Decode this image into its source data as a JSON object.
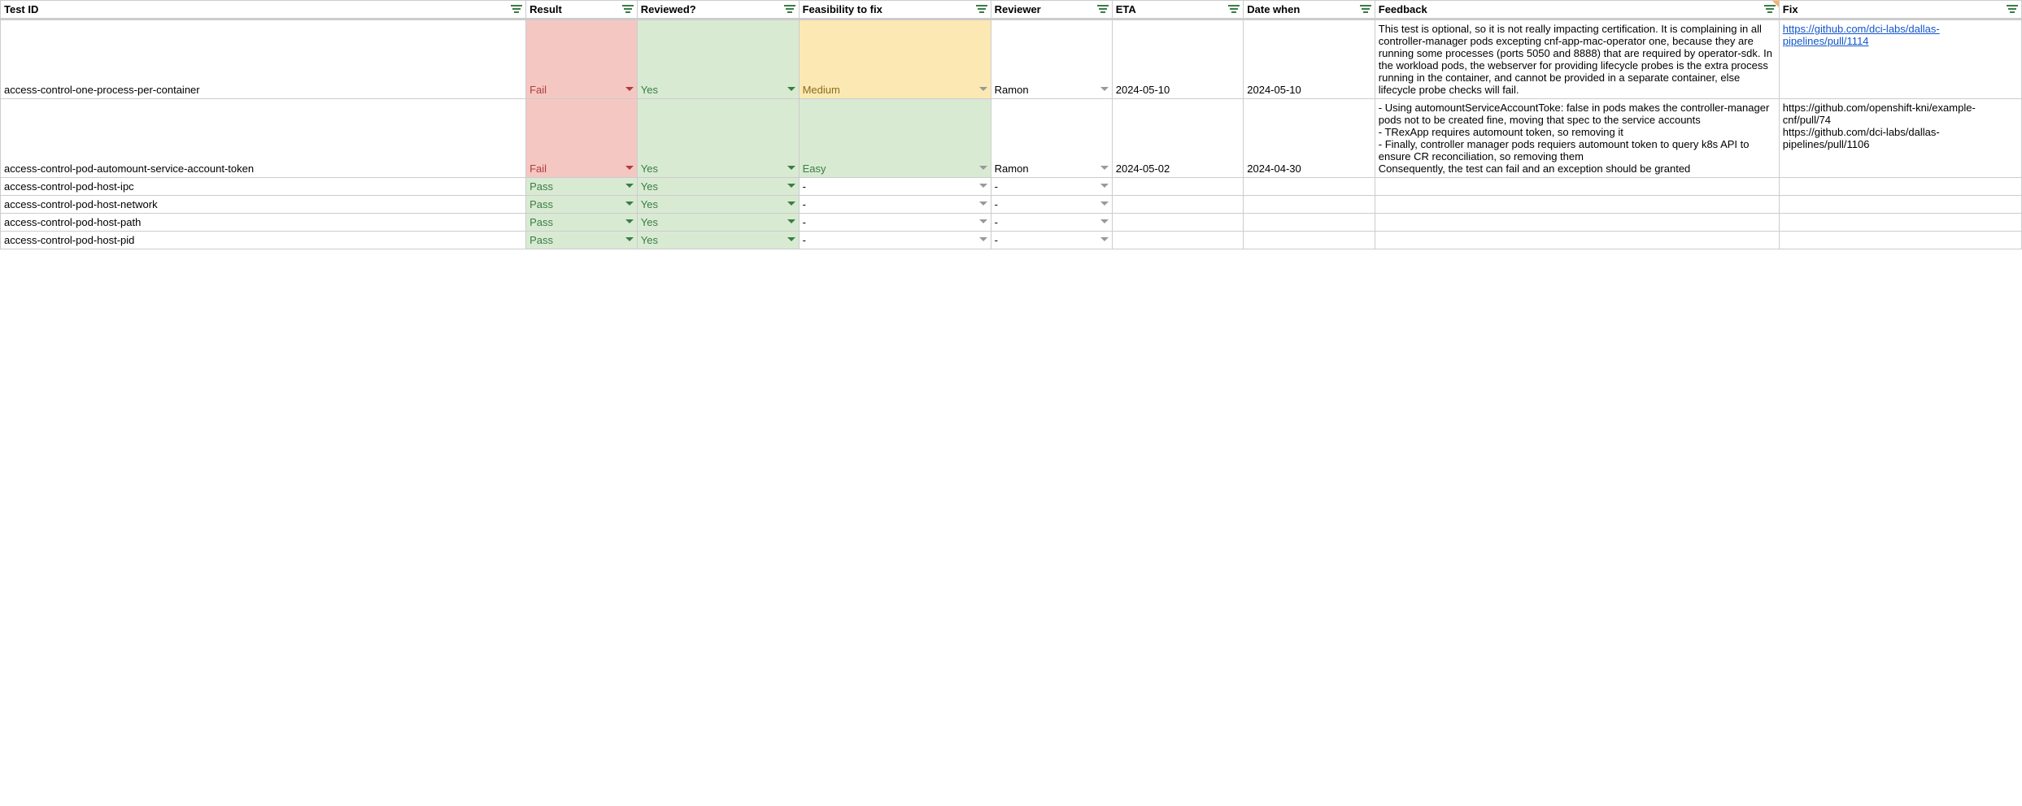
{
  "columns": [
    "Test ID",
    "Result",
    "Reviewed?",
    "Feasibility to fix",
    "Reviewer",
    "ETA",
    "Date when",
    "Feedback",
    "Fix"
  ],
  "rows": [
    {
      "test_id": "access-control-one-process-per-container",
      "result": "Fail",
      "result_class": "bg-red",
      "result_dd": "dd-red",
      "reviewed": "Yes",
      "reviewed_class": "bg-green",
      "feasibility": "Medium",
      "feasibility_class": "bg-yellow",
      "reviewer": "Ramon",
      "eta": "2024-05-10",
      "date_when": "2024-05-10",
      "feedback": "This test is optional, so it is not really impacting certification. It is complaining in all controller-manager pods excepting cnf-app-mac-operator one, because they are running some processes (ports 5050 and 8888) that are required by operator-sdk. In the workload pods, the webserver for providing lifecycle probes is the extra process running in the container, and cannot be provided in a separate container, else lifecycle probe checks will fail.",
      "fix": "https://github.com/dci-labs/dallas-pipelines/pull/1114",
      "fix_is_link": true
    },
    {
      "test_id": "access-control-pod-automount-service-account-token",
      "result": "Fail",
      "result_class": "bg-red",
      "result_dd": "dd-red",
      "reviewed": "Yes",
      "reviewed_class": "bg-green",
      "feasibility": "Easy",
      "feasibility_class": "bg-green",
      "reviewer": "Ramon",
      "eta": "2024-05-02",
      "date_when": "2024-04-30",
      "feedback": "- Using automountServiceAccountToke: false in pods makes the controller-manager pods not to be created fine, moving that spec to the service accounts\n- TRexApp requires automount token, so removing it\n- Finally, controller manager pods requiers automount token to query k8s API to ensure CR reconciliation, so removing them\nConsequently, the test can fail and an exception should be granted",
      "fix": "https://github.com/openshift-kni/example-cnf/pull/74\nhttps://github.com/dci-labs/dallas-pipelines/pull/1106",
      "fix_is_link": false
    },
    {
      "test_id": "access-control-pod-host-ipc",
      "result": "Pass",
      "result_class": "bg-green",
      "result_dd": "dd-green",
      "reviewed": "Yes",
      "reviewed_class": "bg-green",
      "feasibility": "-",
      "feasibility_class": "",
      "reviewer": "-",
      "eta": "",
      "date_when": "",
      "feedback": "",
      "fix": "",
      "fix_is_link": false
    },
    {
      "test_id": "access-control-pod-host-network",
      "result": "Pass",
      "result_class": "bg-green",
      "result_dd": "dd-green",
      "reviewed": "Yes",
      "reviewed_class": "bg-green",
      "feasibility": "-",
      "feasibility_class": "",
      "reviewer": "-",
      "eta": "",
      "date_when": "",
      "feedback": "",
      "fix": "",
      "fix_is_link": false
    },
    {
      "test_id": "access-control-pod-host-path",
      "result": "Pass",
      "result_class": "bg-green",
      "result_dd": "dd-green",
      "reviewed": "Yes",
      "reviewed_class": "bg-green",
      "feasibility": "-",
      "feasibility_class": "",
      "reviewer": "-",
      "eta": "",
      "date_when": "",
      "feedback": "",
      "fix": "",
      "fix_is_link": false
    },
    {
      "test_id": "access-control-pod-host-pid",
      "result": "Pass",
      "result_class": "bg-green",
      "result_dd": "dd-green",
      "reviewed": "Yes",
      "reviewed_class": "bg-green",
      "feasibility": "-",
      "feasibility_class": "",
      "reviewer": "-",
      "eta": "",
      "date_when": "",
      "feedback": "",
      "fix": "",
      "fix_is_link": false
    }
  ]
}
